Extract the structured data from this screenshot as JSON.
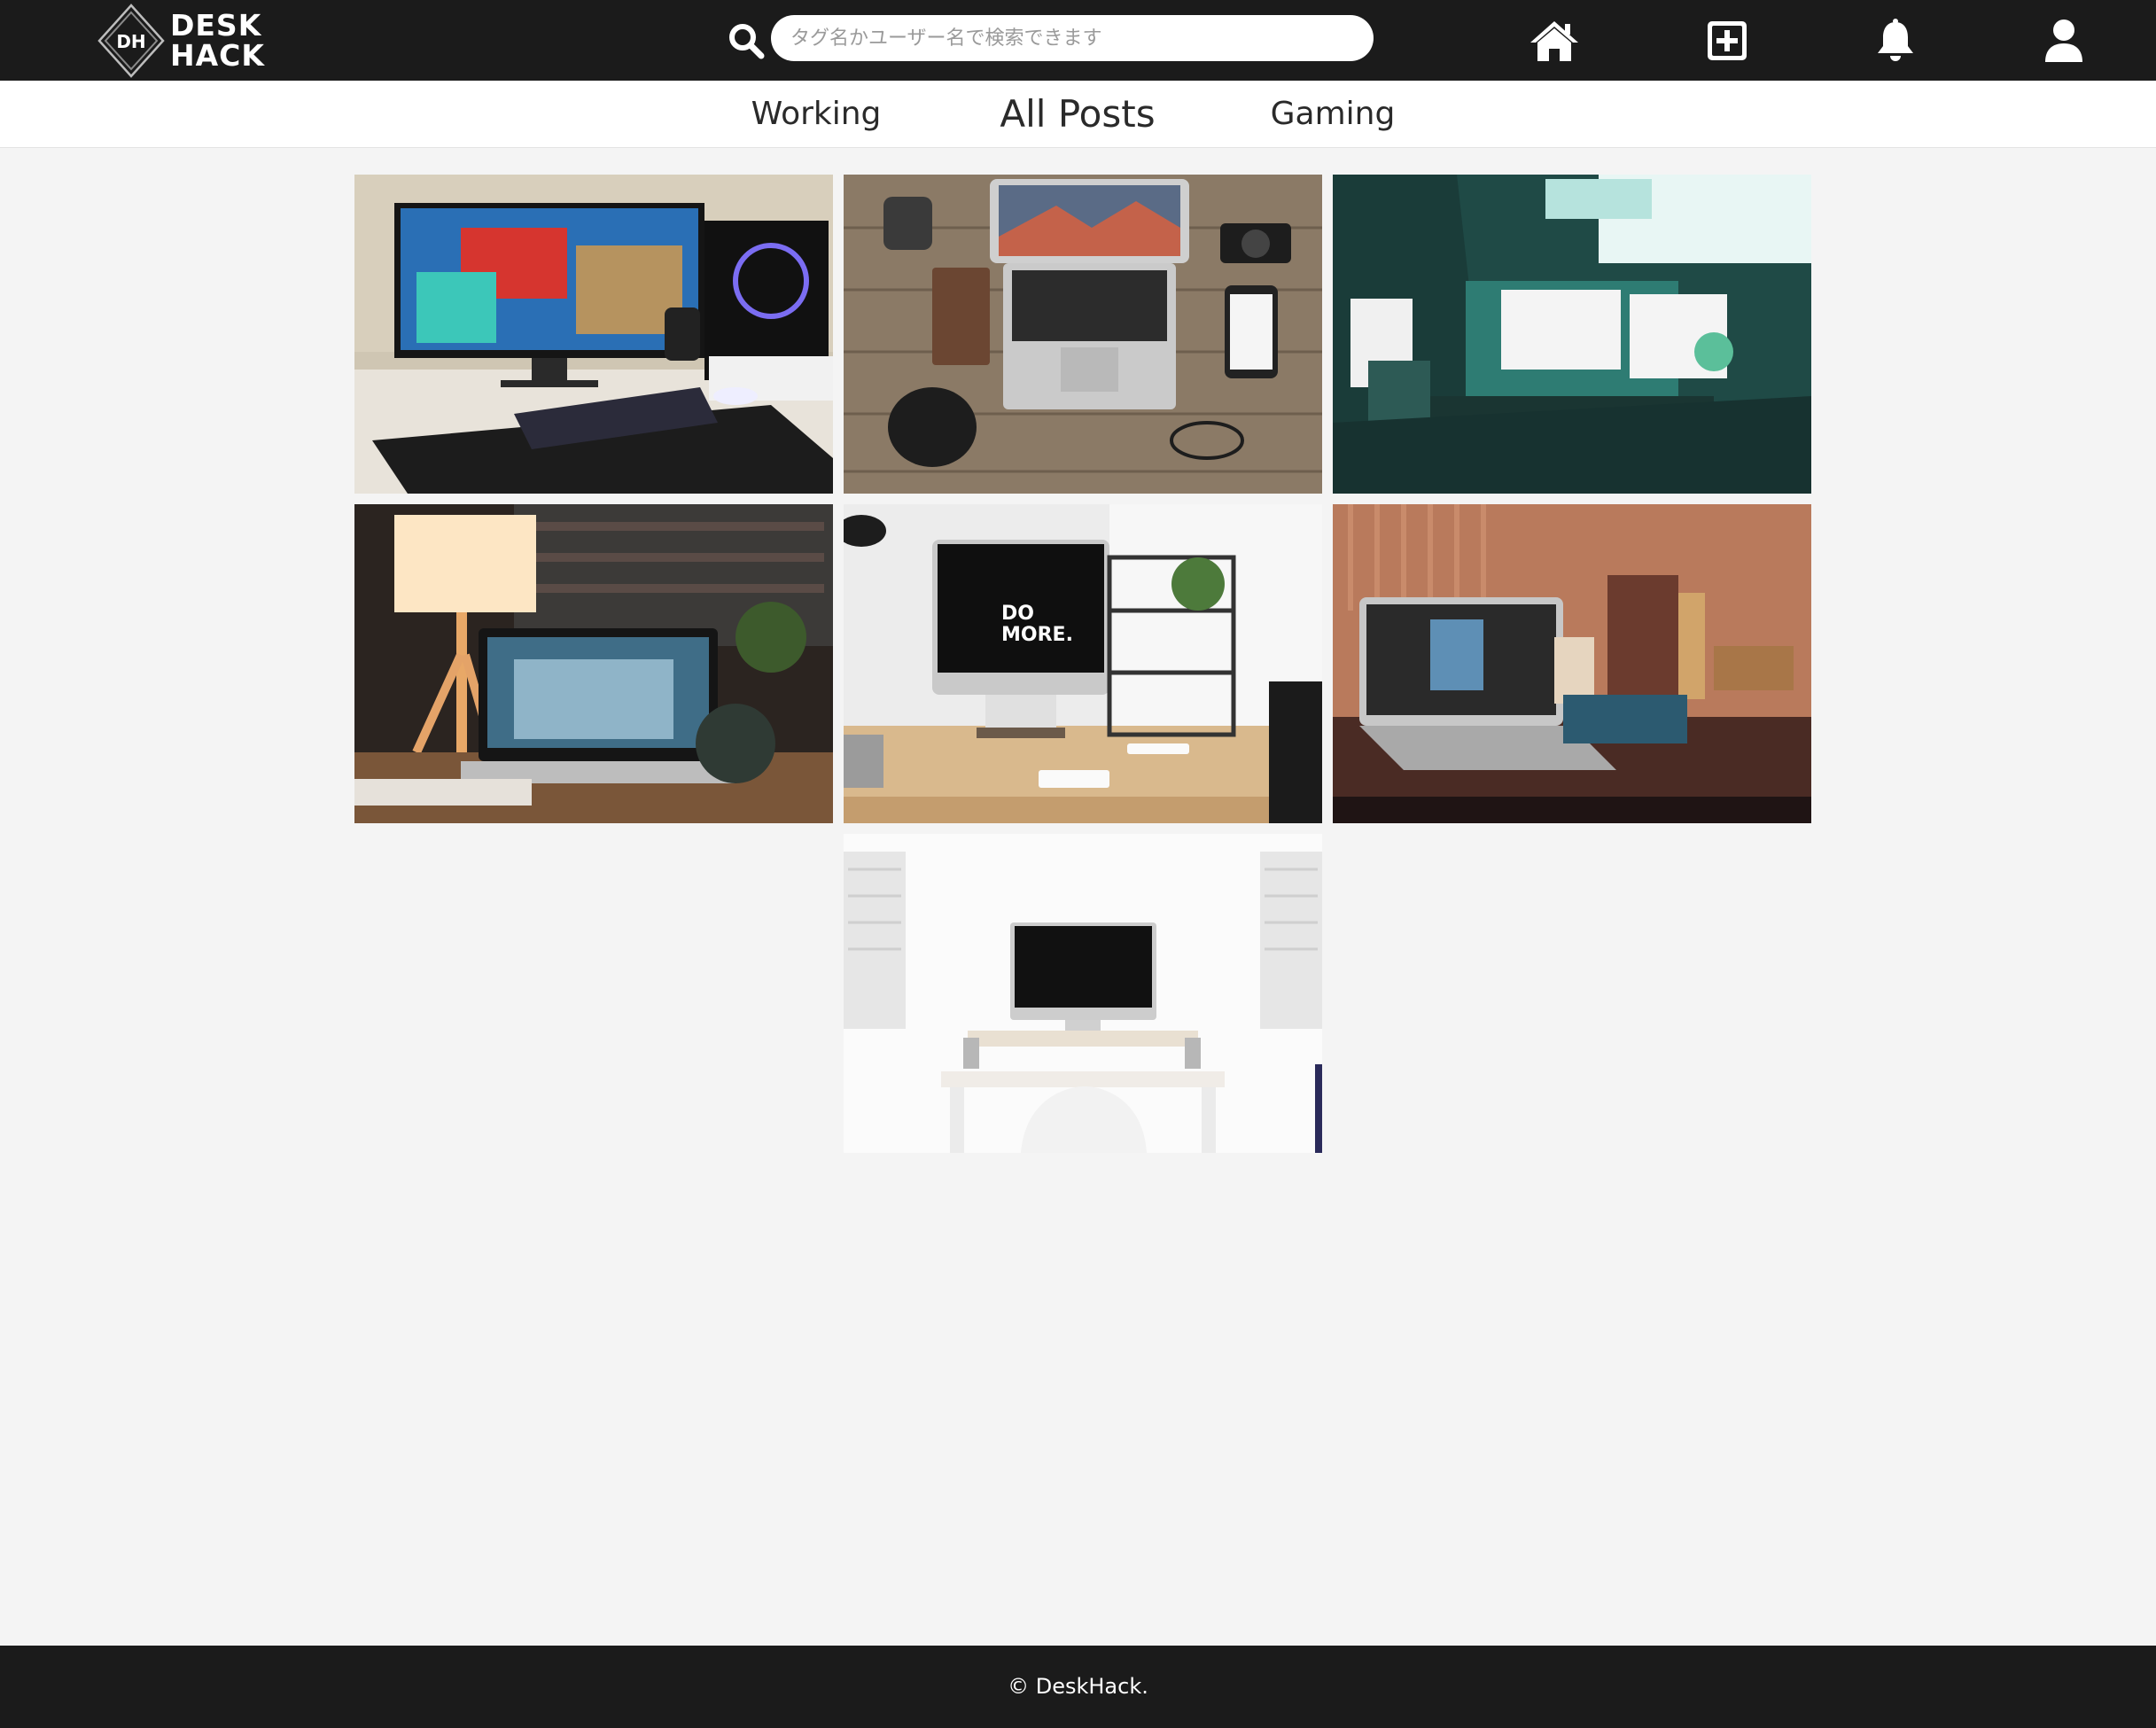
{
  "brand": {
    "logo_mark": "DH",
    "name_line1": "DESK",
    "name_line2": "HACK"
  },
  "search": {
    "placeholder": "タグ名かユーザー名で検索できます",
    "value": ""
  },
  "nav_icons": [
    "home-icon",
    "add-post-icon",
    "bell-icon",
    "user-icon"
  ],
  "tabs": [
    {
      "label": "Working",
      "active": false
    },
    {
      "label": "All Posts",
      "active": true
    },
    {
      "label": "Gaming",
      "active": false
    }
  ],
  "posts": [
    {
      "subject": "gaming desk with monitor and pc case"
    },
    {
      "subject": "laptop on wooden desk flatlay"
    },
    {
      "subject": "teal room with dual monitors"
    },
    {
      "subject": "laptop with desk lamp"
    },
    {
      "subject": "imac do more desk"
    },
    {
      "subject": "laptop on warm toned desk"
    },
    {
      "subject": "white minimal imac workspace"
    }
  ],
  "post_texts": {
    "do_more": "DO\nMORE."
  },
  "footer": {
    "copyright": "© DeskHack."
  },
  "colors": {
    "header_bg": "#1b1b1b",
    "page_bg": "#f4f4f4",
    "tab_bar_bg": "#ffffff",
    "footer_bg": "#1b1b1b"
  }
}
